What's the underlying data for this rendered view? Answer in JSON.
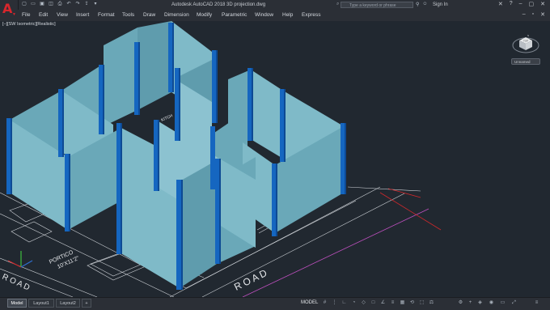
{
  "app": {
    "title": "Autodesk AutoCAD 2018    3D projection.dwg",
    "logo": "A",
    "search_placeholder": "Type a keyword or phrase",
    "sign_in": "Sign In"
  },
  "menu": [
    "File",
    "Edit",
    "View",
    "Insert",
    "Format",
    "Tools",
    "Draw",
    "Dimension",
    "Modify",
    "Parametric",
    "Window",
    "Help",
    "Express"
  ],
  "viewport": {
    "label": "[–][SW Isometric][Realistic]",
    "viewcube_face": "TOP",
    "viewcube_compass": [
      "N",
      "E",
      "S",
      "W"
    ],
    "named_view": "Unnamed"
  },
  "drawing_text": {
    "road_bottom": "R O A D",
    "road_left": "R O A D",
    "portico": "PORTICO",
    "portico_size": "10'X11'2\"",
    "kitchen": "KITCH"
  },
  "statusbar": {
    "tabs": [
      "Model",
      "Layout1",
      "Layout2"
    ],
    "add_tab": "+",
    "model_label": "MODEL",
    "icons": [
      "grid-icon",
      "snap-icon",
      "ortho-icon",
      "polar-icon",
      "isodraft-icon",
      "osnap-icon",
      "otrack-icon",
      "lineweight-icon",
      "transparency-icon",
      "selection-cycling-icon",
      "3dosnap-icon",
      "annotation-scale-icon",
      "workspace-icon",
      "plus-icon",
      "hardware-acceleration-icon",
      "isolate-icon",
      "fullscreen-icon",
      "customize-icon"
    ]
  },
  "colors": {
    "background": "#212830",
    "wall_left": "#7fbac8",
    "wall_right": "#5f9cad",
    "wall_top": "#a7d8e4",
    "column": "#1566c0",
    "column_dark": "#0d4a94",
    "road_line": "#c050c0",
    "red_line": "#d0282c",
    "drawing_lines": "#d0d4d8"
  }
}
